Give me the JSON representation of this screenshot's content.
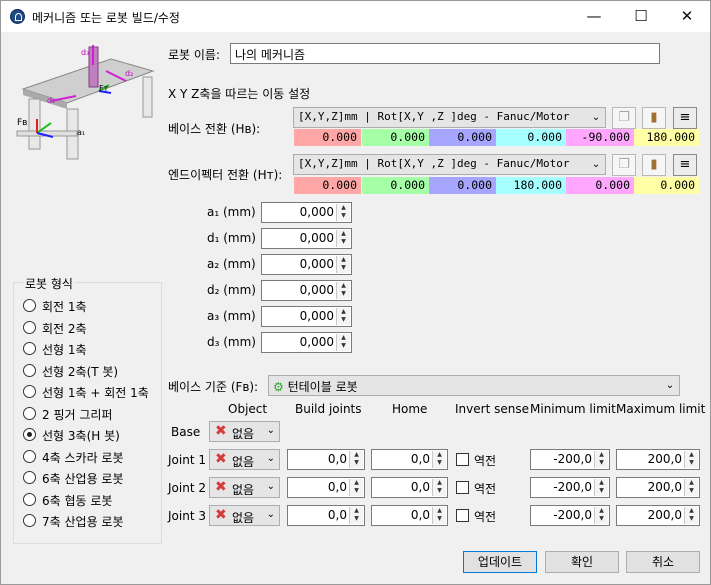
{
  "window": {
    "title": "메커니즘 또는 로봇 빌드/수정",
    "minimize": "—",
    "maximize": "☐",
    "close": "✕"
  },
  "robot_name": {
    "label": "로봇 이름:",
    "value": "나의 메커니즘"
  },
  "xyz_settings_label": "X Y Z축을 따르는 이동 설정",
  "diagram_labels": {
    "d1": "d₁",
    "d2": "d₂",
    "d3": "d₃",
    "a1": "a₁",
    "ft": "Fᴛ",
    "fb": "Fʙ"
  },
  "base_transform": {
    "label": "베이스 전환 (Hʙ):",
    "format": "[X,Y,Z]mm | Rot[X,Y ,Z  ]deg - Fanuc/Motor",
    "values": [
      "0.000",
      "0.000",
      "0.000",
      "0.000",
      "-90.000",
      "180.000"
    ]
  },
  "tool_transform": {
    "label": "엔드이펙터 전환 (Hᴛ):",
    "format": "[X,Y,Z]mm | Rot[X,Y ,Z  ]deg - Fanuc/Motor",
    "values": [
      "0.000",
      "0.000",
      "0.000",
      "180.000",
      "0.000",
      "0.000"
    ]
  },
  "value_colors": [
    "#ffa6a6",
    "#a6ffa6",
    "#a6a6ff",
    "#a6ffff",
    "#ffa6ff",
    "#ffffa6"
  ],
  "params": [
    {
      "label": "a₁ (mm)",
      "value": "0,000"
    },
    {
      "label": "d₁ (mm)",
      "value": "0,000"
    },
    {
      "label": "a₂ (mm)",
      "value": "0,000"
    },
    {
      "label": "d₂ (mm)",
      "value": "0,000"
    },
    {
      "label": "a₃ (mm)",
      "value": "0,000"
    },
    {
      "label": "d₃ (mm)",
      "value": "0,000"
    }
  ],
  "robot_type": {
    "title": "로봇 형식",
    "options": [
      "회전 1축",
      "회전 2축",
      "선형 1축",
      "선형 2축(T 봇)",
      "선형 1축 + 회전 1축",
      "2 핑거 그리퍼",
      "선형 3축(H 봇)",
      "4축 스카라 로봇",
      "6축 산업용 로봇",
      "6축 협동 로봇",
      "7축 산업용 로봇"
    ],
    "selected_index": 6
  },
  "base_ref": {
    "label": "베이스 기준 (Fʙ):",
    "value": "턴테이블 로봇"
  },
  "joints_header": {
    "object": "Object",
    "build": "Build joints",
    "home": "Home",
    "invert": "Invert sense",
    "min": "Minimum limit",
    "max": "Maximum limit"
  },
  "base_row": {
    "label": "Base",
    "object": "없음"
  },
  "joints": [
    {
      "label": "Joint 1",
      "object": "없음",
      "build": "0,0",
      "home": "0,0",
      "invert_label": "역전",
      "invert": false,
      "min": "-200,0",
      "max": "200,0"
    },
    {
      "label": "Joint 2",
      "object": "없음",
      "build": "0,0",
      "home": "0,0",
      "invert_label": "역전",
      "invert": false,
      "min": "-200,0",
      "max": "200,0"
    },
    {
      "label": "Joint 3",
      "object": "없음",
      "build": "0,0",
      "home": "0,0",
      "invert_label": "역전",
      "invert": false,
      "min": "-200,0",
      "max": "200,0"
    }
  ],
  "buttons": {
    "update": "업데이트",
    "ok": "확인",
    "cancel": "취소"
  }
}
